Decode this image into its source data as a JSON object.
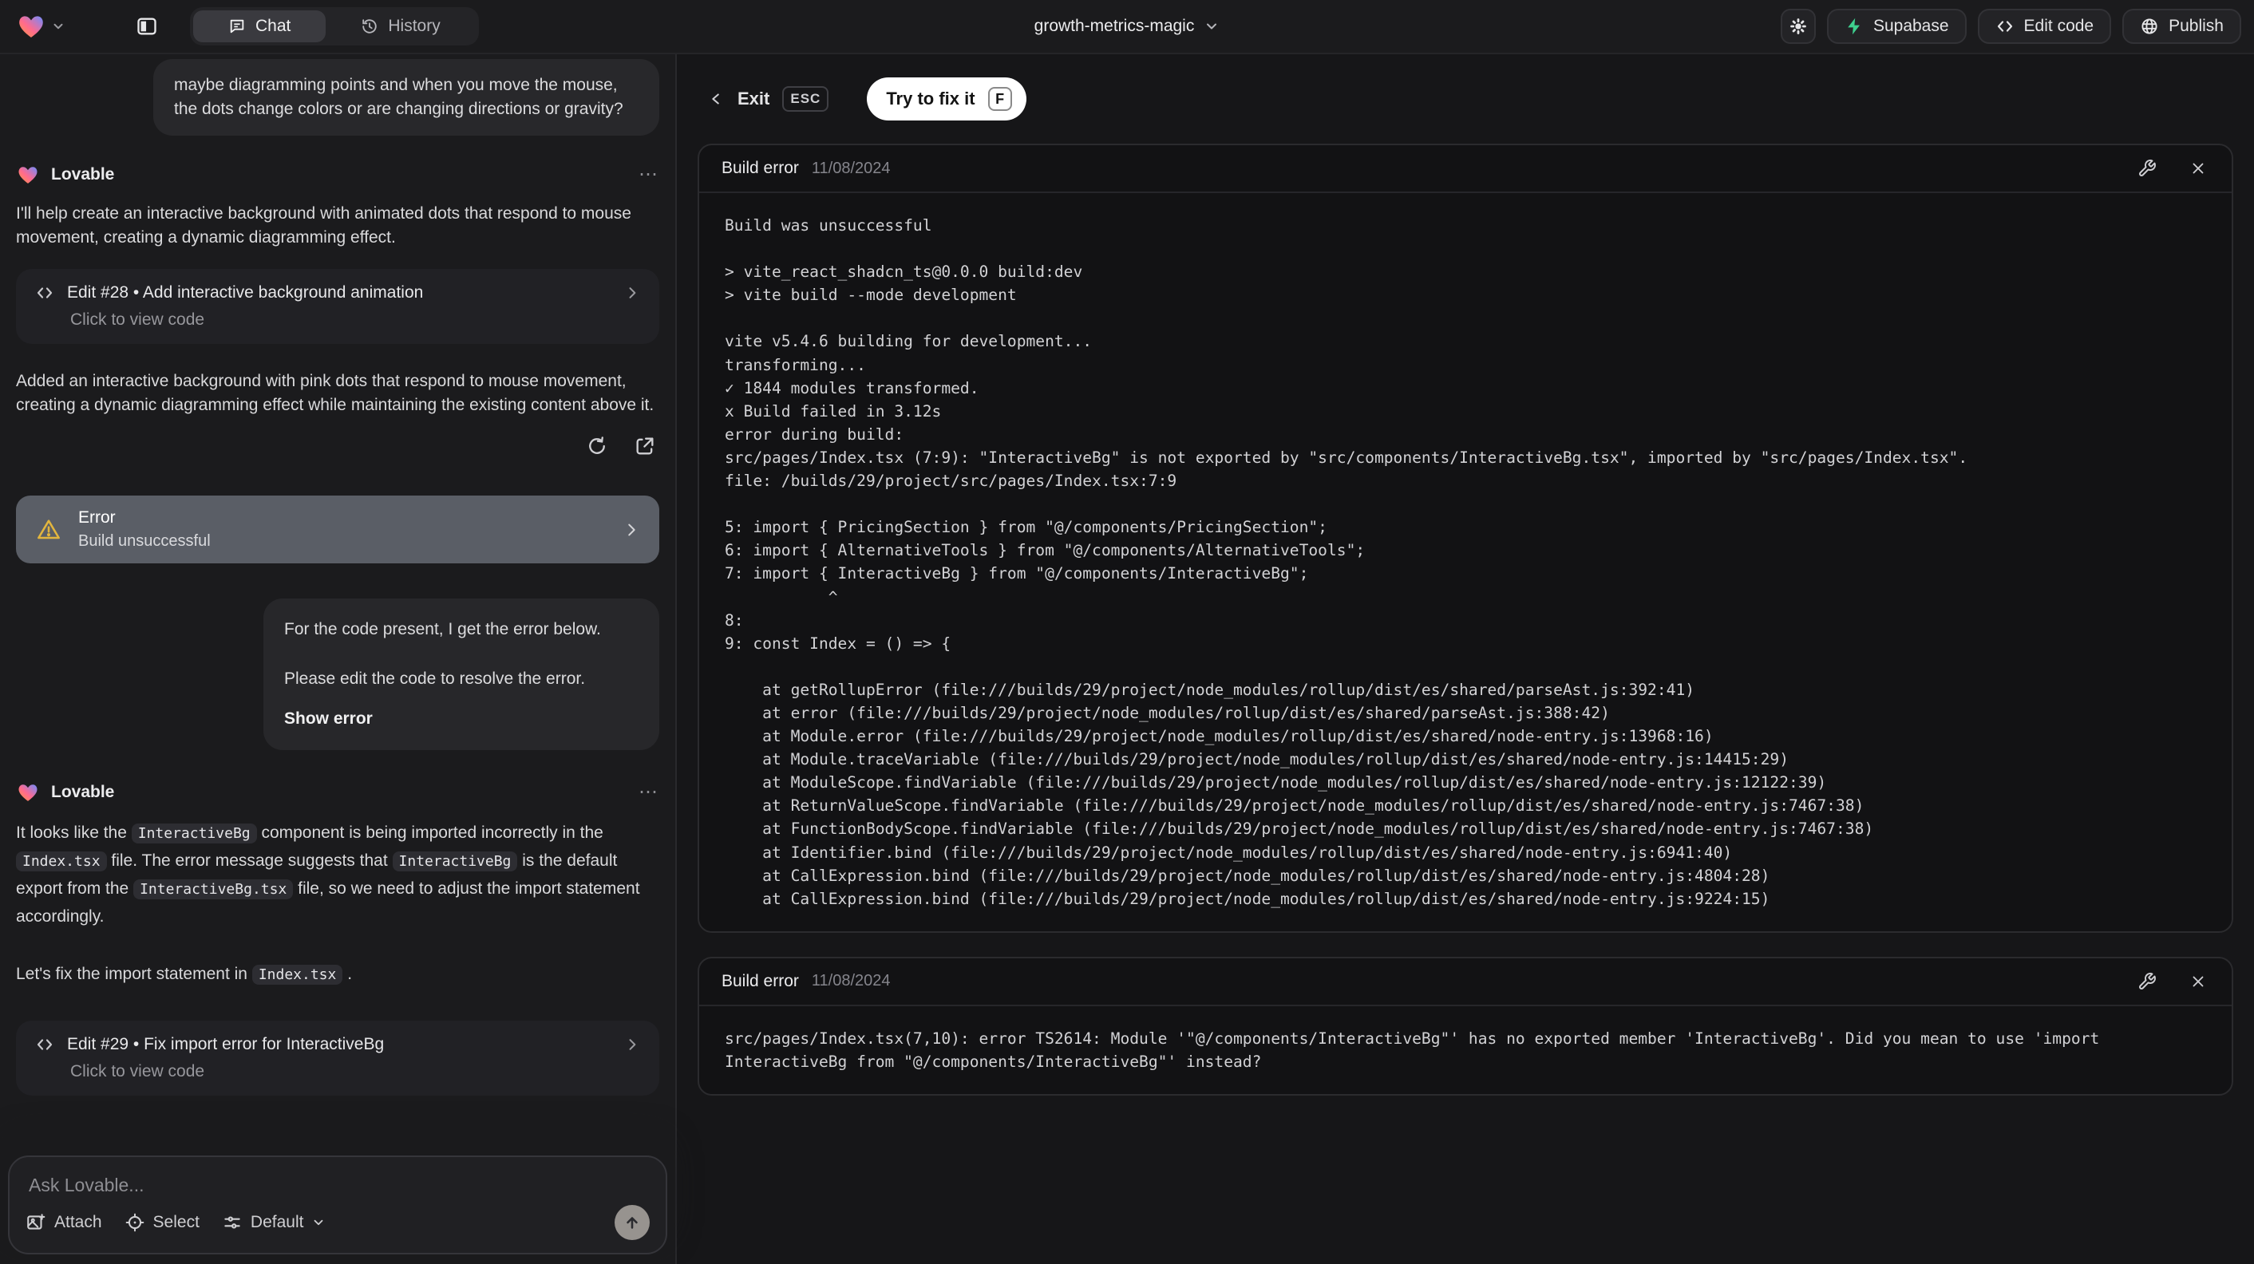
{
  "topbar": {
    "tabs": [
      {
        "label": "Chat"
      },
      {
        "label": "History"
      }
    ],
    "project_name": "growth-metrics-magic",
    "supabase_label": "Supabase",
    "edit_code_label": "Edit code",
    "publish_label": "Publish"
  },
  "chat": {
    "user_message": "maybe diagramming points and when you move the mouse, the dots change colors or are changing directions or gravity?",
    "assistant_name": "Lovable",
    "message1": {
      "intro": "I'll help create an interactive background with animated dots that respond to mouse movement, creating a dynamic diagramming effect.",
      "edit_card": {
        "title": "Edit #28 • Add interactive background animation",
        "subtitle": "Click to view code"
      },
      "result": "Added an interactive background with pink dots that respond to mouse movement, creating a dynamic diagramming effect while maintaining the existing content above it.",
      "error_card": {
        "title": "Error",
        "subtitle": "Build unsuccessful"
      }
    },
    "followup": {
      "line1": "For the code present, I get the error below.",
      "line2": "Please edit the code to resolve the error.",
      "action": "Show error"
    },
    "message2": {
      "segments": [
        {
          "t": "text",
          "v": "It looks like the "
        },
        {
          "t": "code",
          "v": "InteractiveBg"
        },
        {
          "t": "text",
          "v": " component is being imported incorrectly in the "
        },
        {
          "t": "code",
          "v": "Index.tsx"
        },
        {
          "t": "text",
          "v": " file. The error message suggests that "
        },
        {
          "t": "code",
          "v": "InteractiveBg"
        },
        {
          "t": "text",
          "v": " is the default export from the "
        },
        {
          "t": "code",
          "v": "InteractiveBg.tsx"
        },
        {
          "t": "text",
          "v": " file, so we need to adjust the import statement accordingly."
        }
      ],
      "fix_segments": [
        {
          "t": "text",
          "v": "Let's fix the import statement in "
        },
        {
          "t": "code",
          "v": "Index.tsx"
        },
        {
          "t": "text",
          "v": " ."
        }
      ],
      "edit_card": {
        "title": "Edit #29 • Fix import error for InteractiveBg",
        "subtitle": "Click to view code"
      }
    },
    "composer": {
      "placeholder": "Ask Lovable...",
      "attach_label": "Attach",
      "select_label": "Select",
      "mode_label": "Default"
    }
  },
  "preview": {
    "exit_label": "Exit",
    "esc_key": "ESC",
    "fix_label": "Try to fix it",
    "fix_key": "F",
    "cards": [
      {
        "title": "Build error",
        "date": "11/08/2024",
        "log_lines": [
          "Build was unsuccessful",
          "",
          "> vite_react_shadcn_ts@0.0.0 build:dev",
          "> vite build --mode development",
          "",
          "vite v5.4.6 building for development...",
          "transforming...",
          "✓ 1844 modules transformed.",
          "x Build failed in 3.12s",
          "error during build:",
          "src/pages/Index.tsx (7:9): \"InteractiveBg\" is not exported by \"src/components/InteractiveBg.tsx\", imported by \"src/pages/Index.tsx\".",
          "file: /builds/29/project/src/pages/Index.tsx:7:9",
          "",
          "5: import { PricingSection } from \"@/components/PricingSection\";",
          "6: import { AlternativeTools } from \"@/components/AlternativeTools\";",
          "7: import { InteractiveBg } from \"@/components/InteractiveBg\";",
          "           ^",
          "8:",
          "9: const Index = () => {",
          "",
          "    at getRollupError (file:///builds/29/project/node_modules/rollup/dist/es/shared/parseAst.js:392:41)",
          "    at error (file:///builds/29/project/node_modules/rollup/dist/es/shared/parseAst.js:388:42)",
          "    at Module.error (file:///builds/29/project/node_modules/rollup/dist/es/shared/node-entry.js:13968:16)",
          "    at Module.traceVariable (file:///builds/29/project/node_modules/rollup/dist/es/shared/node-entry.js:14415:29)",
          "    at ModuleScope.findVariable (file:///builds/29/project/node_modules/rollup/dist/es/shared/node-entry.js:12122:39)",
          "    at ReturnValueScope.findVariable (file:///builds/29/project/node_modules/rollup/dist/es/shared/node-entry.js:7467:38)",
          "    at FunctionBodyScope.findVariable (file:///builds/29/project/node_modules/rollup/dist/es/shared/node-entry.js:7467:38)",
          "    at Identifier.bind (file:///builds/29/project/node_modules/rollup/dist/es/shared/node-entry.js:6941:40)",
          "    at CallExpression.bind (file:///builds/29/project/node_modules/rollup/dist/es/shared/node-entry.js:4804:28)",
          "    at CallExpression.bind (file:///builds/29/project/node_modules/rollup/dist/es/shared/node-entry.js:9224:15)"
        ]
      },
      {
        "title": "Build error",
        "date": "11/08/2024",
        "log_lines": [
          "src/pages/Index.tsx(7,10): error TS2614: Module '\"@/components/InteractiveBg\"' has no exported member 'InteractiveBg'. Did you mean to use 'import InteractiveBg from \"@/components/InteractiveBg\"' instead?"
        ]
      }
    ]
  },
  "colors": {
    "warning": "#e2b53e",
    "supabase_green": "#3ecf8e",
    "error_card_bg": "#5a5e66",
    "fix_button_bg": "#ffffff"
  }
}
